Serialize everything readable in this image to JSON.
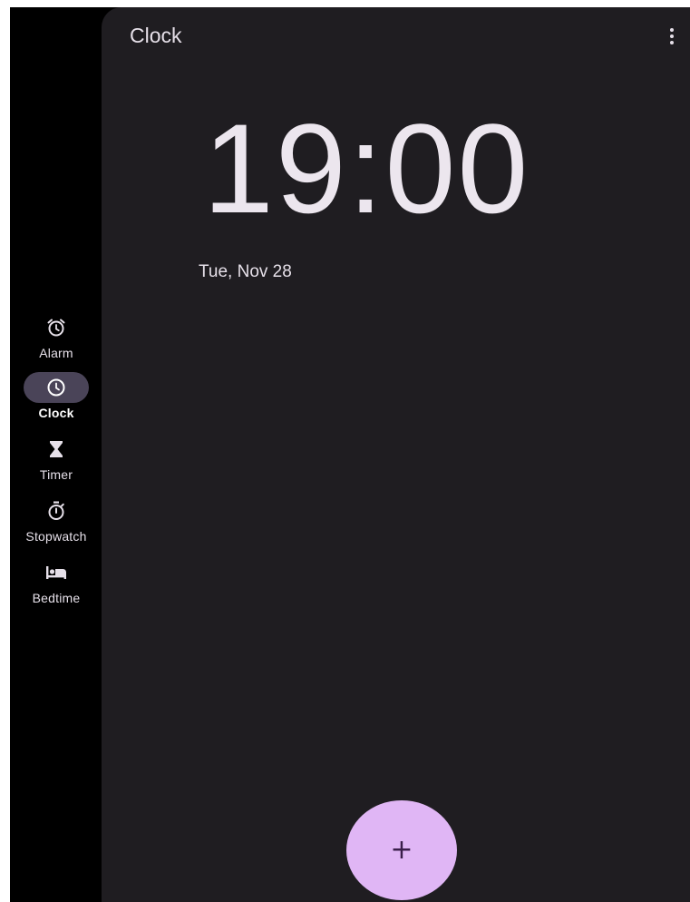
{
  "app": {
    "title": "Clock"
  },
  "nav": {
    "items": [
      {
        "label": "Alarm",
        "icon": "alarm-icon",
        "active": false
      },
      {
        "label": "Clock",
        "icon": "clock-icon",
        "active": true
      },
      {
        "label": "Timer",
        "icon": "hourglass-icon",
        "active": false
      },
      {
        "label": "Stopwatch",
        "icon": "stopwatch-icon",
        "active": false
      },
      {
        "label": "Bedtime",
        "icon": "bed-icon",
        "active": false
      }
    ]
  },
  "clock": {
    "time": "19:00",
    "date": "Tue, Nov 28"
  },
  "fab": {
    "icon": "plus-icon",
    "symbol": "+"
  },
  "colors": {
    "background": "#1f1d21",
    "rail_background": "#000000",
    "active_indicator": "#4a4458",
    "fab": "#e0b6f5",
    "text": "#e6e0e9"
  }
}
